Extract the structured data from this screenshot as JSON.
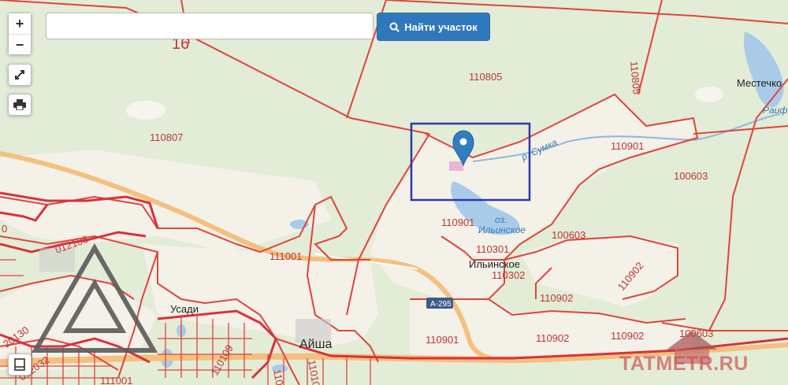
{
  "search": {
    "placeholder": "",
    "value": "",
    "button_label": "Найти участок"
  },
  "controls": {
    "zoom_in": "+",
    "zoom_out": "−"
  },
  "map": {
    "labels": {
      "p110805a": "110805",
      "p110805b": "110805",
      "p110807": "110807",
      "p110901a": "110901",
      "p110901b": "110901",
      "p110901c": "110901",
      "p100603a": "100603",
      "p100603b": "100603",
      "p100603c": "100603",
      "p012106": "012106",
      "p111001a": "111001",
      "p111001b": "111001",
      "p110301": "110301",
      "p110302": "110302",
      "p110902a": "110902",
      "p110902b": "110902",
      "p110902c": "110902",
      "p110902d": "110902",
      "p110109": "110109",
      "p110108": "11010",
      "p110107": "11010",
      "p012032": "012032",
      "p012030": "20130",
      "p_left0": "0",
      "p_top16": "16",
      "village_ilinskoe": "Ильинское",
      "village_aysha": "Айша",
      "village_usadi": "Усади",
      "village_mestechko": "Местечко",
      "lake_ozero": "оз.",
      "lake_name": "Ильинское",
      "river_sumka": "р. Сумка",
      "river_raifa": "Раиф",
      "road_a295": "А-295"
    }
  },
  "watermark": "TATMETR.RU",
  "colors": {
    "boundary": "#e0443c",
    "boundary_thick": "#d9323c",
    "meadow": "#f2f1e8",
    "forest": "#dfebd3",
    "water": "#a9cbe9",
    "road_orange": "#f4c07e",
    "button_blue": "#2f78bc",
    "highlight_box": "#2b3aa8",
    "marker": "#2f7fc0"
  }
}
